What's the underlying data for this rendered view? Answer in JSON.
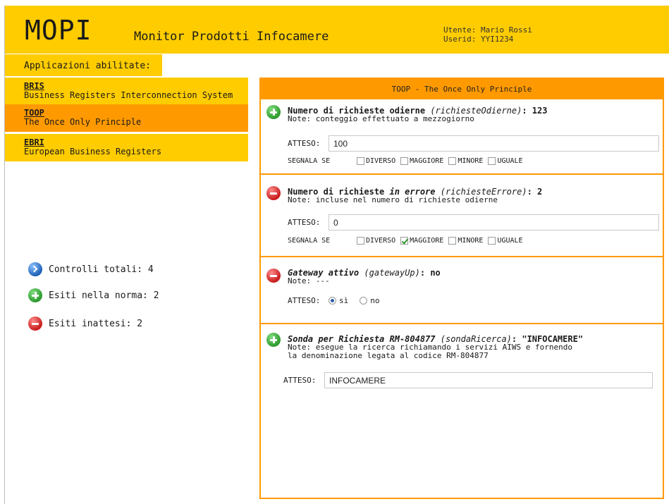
{
  "header": {
    "logo": "MOPI",
    "title": "Monitor Prodotti Infocamere",
    "user_line": "Utente: Mario Rossi",
    "userid_line": "Userid: YYI1234"
  },
  "sidebar": {
    "heading": "Applicazioni abilitate:",
    "items": [
      {
        "code": "BRIS",
        "name": "Business Registers Interconnection System"
      },
      {
        "code": "TOOP",
        "name": "The Once Only Principle"
      },
      {
        "code": "EBRI",
        "name": "European Business Registers"
      }
    ],
    "summary": {
      "total": "Controlli totali: 4",
      "ok": "Esiti nella norma: 2",
      "unexpected": "Esiti inattesi: 2"
    }
  },
  "panel": {
    "title": "TOOP - The Once Only Principle",
    "checks": [
      {
        "name_a": "Numero di richieste odierne",
        "name_b": "",
        "name_c": "",
        "key": "(richiesteOdierne)",
        "value": ": 123",
        "note": "Note: conteggio effettuato a mezzogiorno",
        "atteso_label": "ATTESO:",
        "atteso_value": "100",
        "segnala_label": "SEGNALA SE",
        "options": [
          "DIVERSO",
          "MAGGIORE",
          "MINORE",
          "UGUALE"
        ],
        "checked": []
      },
      {
        "name_a": "Numero di richieste ",
        "name_b": "in errore",
        "name_c": "",
        "key": "(richiesteErrore)",
        "value": ": 2",
        "note": "Note: incluse nel numero di richieste odierne",
        "atteso_label": "ATTESO:",
        "atteso_value": "0",
        "segnala_label": "SEGNALA SE",
        "options": [
          "DIVERSO",
          "MAGGIORE",
          "MINORE",
          "UGUALE"
        ],
        "checked": [
          "MAGGIORE"
        ]
      },
      {
        "name_italic": "Gateway attivo",
        "key": "(gatewayUp)",
        "value": ": no",
        "note": "Note: ---",
        "atteso_label": "ATTESO:",
        "radio_options": [
          "sì",
          "no"
        ],
        "radio_selected": "sì"
      },
      {
        "name_italic": "Sonda per Richiesta RM-804877",
        "key": "(sondaRicerca)",
        "value": ": \"INFOCAMERE\"",
        "note_line1": "Note: esegue la ricerca richiamando i servizi AIWS e fornendo",
        "note_line2": "la denominazione legata al codice RM-804877",
        "atteso_label": "ATTESO:",
        "atteso_value": "INFOCAMERE"
      }
    ]
  },
  "colors": {
    "yellow": "#ffcc00",
    "orange": "#ff9900",
    "ok_green": "#2e9a2e",
    "error_red": "#c81c1c"
  }
}
